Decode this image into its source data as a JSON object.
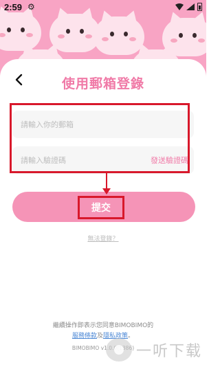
{
  "status_bar": {
    "time": "2:59"
  },
  "header": {
    "title": "使用郵箱登錄"
  },
  "form": {
    "email_placeholder": "請輸入你的郵箱",
    "code_placeholder": "請輸入驗證碼",
    "send_code_label": "發送驗證碼",
    "submit_label": "提交",
    "cannot_login_label": "無法登錄？"
  },
  "footer": {
    "agreement_prefix": "繼續操作即表示您同意BIMOBIMO的",
    "terms_link": "服務條款",
    "and_text": "及",
    "privacy_link": "隱私政策",
    "period": "。",
    "version": "BIMOBIMO v1.0.0(1386)"
  },
  "watermark": {
    "text": "一听下载"
  },
  "colors": {
    "header_pink": "#f8a4c4",
    "accent_pink": "#f07aa7",
    "button_pink": "#f594b7",
    "annotation_red": "#d8182b",
    "link_blue": "#4f8ad6"
  }
}
